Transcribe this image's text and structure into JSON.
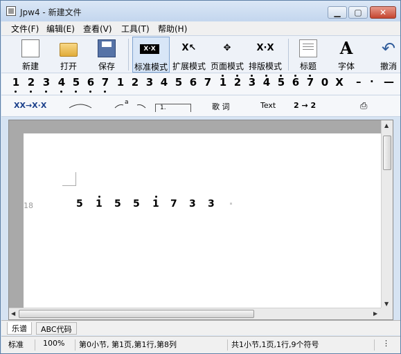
{
  "window": {
    "title": "Jpw4 - 新建文件"
  },
  "menu": [
    "文件(F)",
    "编辑(E)",
    "查看(V)",
    "工具(T)",
    "帮助(H)"
  ],
  "toolbar": {
    "new": "新建",
    "open": "打开",
    "save": "保存",
    "std_mode": "标准模式",
    "ext_mode": "扩展模式",
    "page_mode": "页面模式",
    "layout_mode": "排版模式",
    "heading": "标题",
    "font": "字体",
    "undo": "撤消"
  },
  "notes_bar": {
    "low": [
      "1",
      "2",
      "3",
      "4",
      "5",
      "6",
      "7"
    ],
    "mid": [
      "1",
      "2",
      "3",
      "4",
      "5",
      "6",
      "7"
    ],
    "high": [
      "1",
      "2",
      "3",
      "4",
      "5",
      "6",
      "7"
    ],
    "rest": "0",
    "x": "X",
    "dash": "–",
    "dot": "·",
    "line": "—"
  },
  "tool3": {
    "triplet": "XX→X·X",
    "lyrics": "歌 词",
    "text": "Text",
    "slur_num": "a",
    "bracket": "1.",
    "transpose": "2 → 2"
  },
  "score": {
    "line_number": "18",
    "notes": [
      {
        "digit": "5",
        "dot": false
      },
      {
        "digit": "1",
        "dot": true
      },
      {
        "digit": "5",
        "dot": false
      },
      {
        "digit": "5",
        "dot": false
      },
      {
        "digit": "1",
        "dot": true
      },
      {
        "digit": "7",
        "dot": false
      },
      {
        "digit": "3",
        "dot": false
      },
      {
        "digit": "3",
        "dot": false
      }
    ]
  },
  "tabs": [
    "乐谱",
    "ABC代码"
  ],
  "status": {
    "mode": "标准",
    "zoom": "100%",
    "position": "第0小节, 第1页,第1行,第8列",
    "summary": "共1小节,1页,1行,9个符号"
  }
}
